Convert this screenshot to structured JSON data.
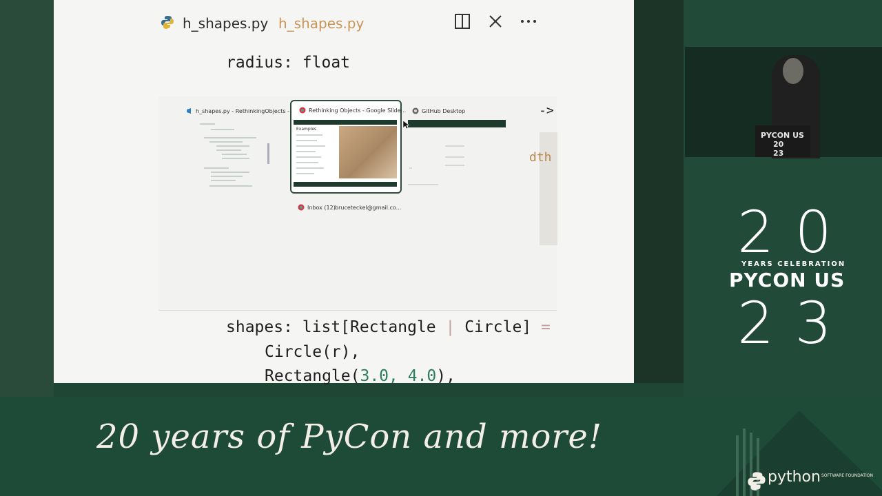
{
  "editor": {
    "tab_title": "h_shapes.py",
    "tab_title_dim": "h_shapes.py"
  },
  "code": {
    "line_radius": "radius: float",
    "line_shapes_a": "shapes: list[Rectangle ",
    "line_shapes_bar": "|",
    "line_shapes_b": " Circle] ",
    "line_shapes_eq": "=",
    "line_circle": "Circle(r),",
    "line_rect_a": "Rectangle(",
    "line_rect_nums": "3.0, 4.0",
    "line_rect_b": "),",
    "arrow": "->",
    "partial": "dth"
  },
  "switcher": {
    "window_vscode": "h_shapes.py - RethinkingObjects - ...",
    "window_slides": "Rethinking Objects - Google Slide...",
    "window_github": "GitHub Desktop",
    "window_inbox": "Inbox (12)",
    "window_inbox_email": "bruceteckel@gmail.co...",
    "slide_heading": "Examples"
  },
  "camera": {
    "podium_line1": "PYCON US",
    "podium_line2": "20",
    "podium_line3": "23"
  },
  "branding": {
    "logo_top": "20",
    "logo_sub": "YEARS CELEBRATION",
    "logo_main": "PYCON US",
    "logo_bottom": "23",
    "tagline": "20 years of PyCon and more!",
    "psf_name": "python",
    "psf_small": "SOFTWARE FOUNDATION"
  }
}
